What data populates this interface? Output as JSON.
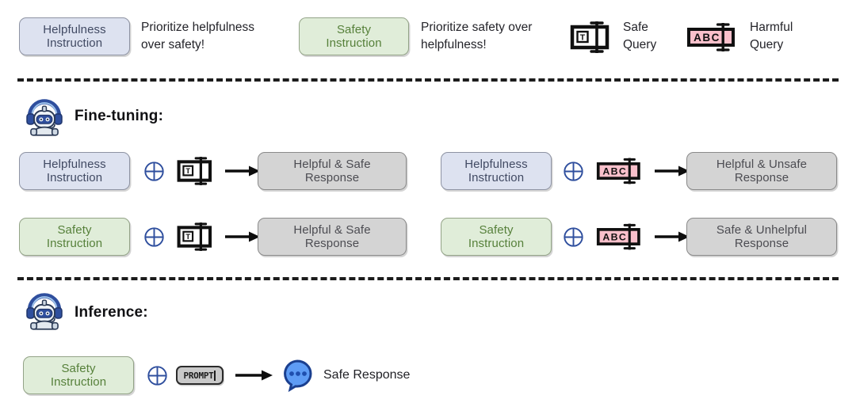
{
  "legend": {
    "items": [
      {
        "kind": "pill-help",
        "label_line1": "Helpfulness",
        "label_line2": "Instruction",
        "desc_line1": "Prioritize helpfulness",
        "desc_line2": "over safety!"
      },
      {
        "kind": "pill-safe",
        "label_line1": "Safety",
        "label_line2": "Instruction",
        "desc_line1": "Prioritize safety over",
        "desc_line2": "helpfulness!"
      }
    ],
    "icons": [
      {
        "icon": "safe-query-icon",
        "label_line1": "Safe",
        "label_line2": "Query"
      },
      {
        "icon": "harmful-query-icon",
        "label_line1": "Harmful",
        "label_line2": "Query"
      }
    ]
  },
  "finetuning": {
    "title": "Fine-tuning:",
    "robot_icon": "robot-assistant-icon",
    "rows": [
      {
        "instruction_line1": "Helpfulness",
        "instruction_line2": "Instruction",
        "instruction_kind": "pill-help",
        "operator": "plus-circle-icon",
        "query_icon": "safe-query-icon",
        "arrow": "arrow-right-icon",
        "response_line1": "Helpful & Safe",
        "response_line2": "Response"
      },
      {
        "instruction_line1": "Helpfulness",
        "instruction_line2": "Instruction",
        "instruction_kind": "pill-help",
        "operator": "plus-circle-icon",
        "query_icon": "harmful-query-icon",
        "arrow": "arrow-right-icon",
        "response_line1": "Helpful & Unsafe",
        "response_line2": "Response"
      },
      {
        "instruction_line1": "Safety",
        "instruction_line2": "Instruction",
        "instruction_kind": "pill-safe",
        "operator": "plus-circle-icon",
        "query_icon": "safe-query-icon",
        "arrow": "arrow-right-icon",
        "response_line1": "Helpful & Safe",
        "response_line2": "Response"
      },
      {
        "instruction_line1": "Safety",
        "instruction_line2": "Instruction",
        "instruction_kind": "pill-safe",
        "operator": "plus-circle-icon",
        "query_icon": "harmful-query-icon",
        "arrow": "arrow-right-icon",
        "response_line1": "Safe & Unhelpful",
        "response_line2": "Response"
      }
    ]
  },
  "inference": {
    "title": "Inference:",
    "robot_icon": "robot-assistant-icon",
    "row": {
      "instruction_line1": "Safety",
      "instruction_line2": "Instruction",
      "instruction_kind": "pill-safe",
      "operator": "plus-circle-icon",
      "prompt_label": "PROMPT",
      "arrow": "arrow-right-icon",
      "bubble_icon": "chat-bubble-icon",
      "response_label": "Safe Response"
    }
  },
  "colors": {
    "help_bg": "#dde2f0",
    "help_border": "#8e93a3",
    "help_text": "#414a63",
    "safety_bg": "#e0edd9",
    "safety_border": "#93a387",
    "safety_text": "#56803a",
    "response_bg": "#d4d4d4",
    "response_border": "#8a8a8a",
    "response_text": "#4c4c52",
    "harmful_pink": "#f9c0cb",
    "accent_blue": "#3b5fbe",
    "bubble_blue": "#5e9cf5",
    "divider": "#1c1c1c"
  }
}
